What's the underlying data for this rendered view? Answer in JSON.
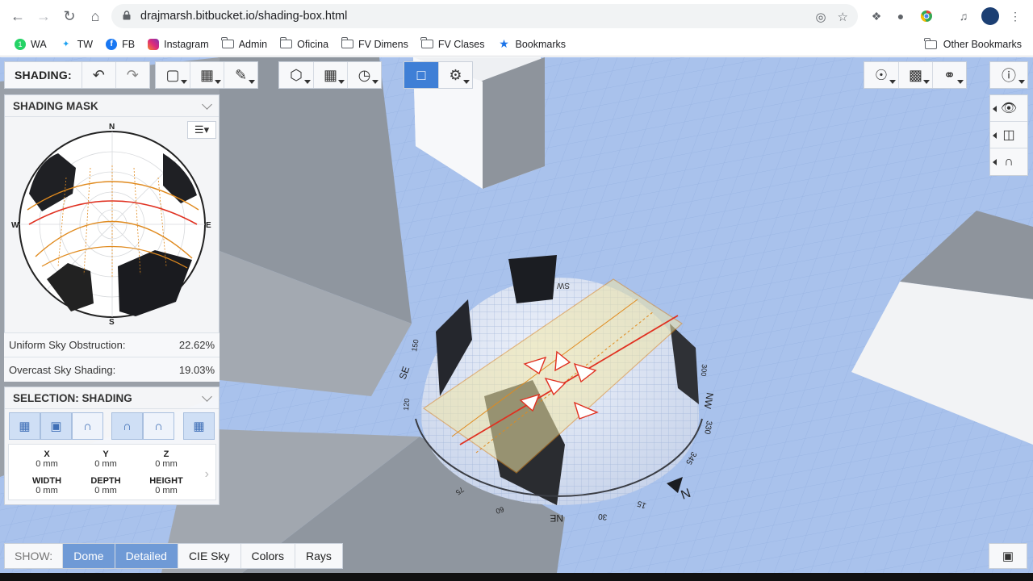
{
  "browser": {
    "url": "drajmarsh.bitbucket.io/shading-box.html",
    "bookmarks": [
      "WA",
      "TW",
      "FB",
      "Instagram",
      "Admin",
      "Oficina",
      "FV Dimens",
      "FV Clases",
      "Bookmarks"
    ],
    "other_bookmarks": "Other Bookmarks"
  },
  "toolbar": {
    "title": "SHADING:"
  },
  "shading_mask": {
    "title": "SHADING MASK",
    "compass": {
      "n": "N",
      "e": "E",
      "s": "S",
      "w": "W"
    },
    "uniform_label": "Uniform Sky Obstruction:",
    "uniform_value": "22.62%",
    "overcast_label": "Overcast Sky Shading:",
    "overcast_value": "19.03%"
  },
  "selection": {
    "title": "SELECTION: SHADING",
    "x_label": "X",
    "x_value": "0 mm",
    "y_label": "Y",
    "y_value": "0 mm",
    "z_label": "Z",
    "z_value": "0 mm",
    "width_label": "WIDTH",
    "width_value": "0 mm",
    "depth_label": "DEPTH",
    "depth_value": "0 mm",
    "height_label": "HEIGHT",
    "height_value": "0 mm"
  },
  "show": {
    "label": "SHOW:",
    "items": [
      "Dome",
      "Detailed",
      "CIE Sky",
      "Colors",
      "Rays"
    ]
  },
  "dome_labels": {
    "se": "SE",
    "ne": "NE",
    "nw": "NW",
    "sw": "SW",
    "n": "N",
    "d150": "150",
    "d120": "120",
    "d60": "60",
    "d30": "30",
    "d15": "15",
    "d330": "330",
    "d345": "345",
    "d300": "300",
    "d75": "75"
  },
  "colors": {
    "ground": "#a9c2ec",
    "active": "#3f7fd6",
    "sunpath": "#e08a1e",
    "red": "#e03020"
  }
}
